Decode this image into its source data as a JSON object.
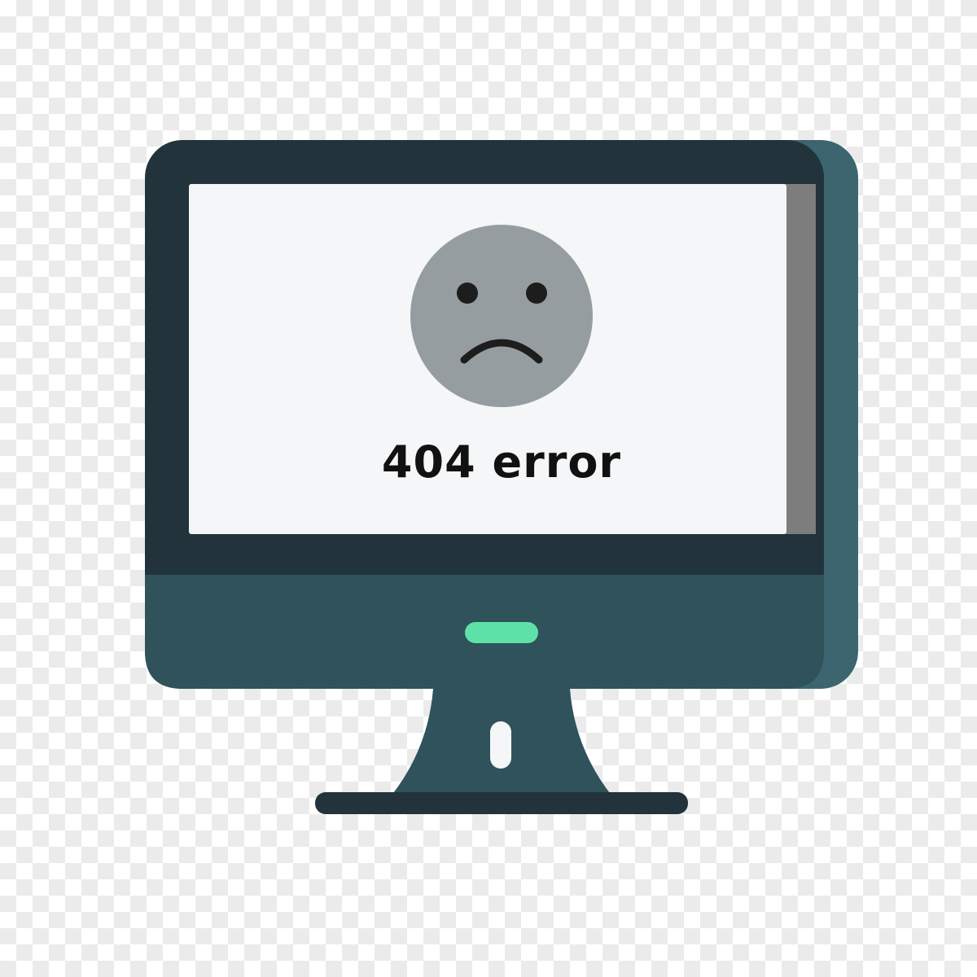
{
  "screen": {
    "message": "404 error"
  },
  "colors": {
    "bezel": "#22333b",
    "bezel_side": "#3c6570",
    "chin": "#2f525b",
    "screen_bg": "#f4f6f8",
    "screen_shadow": "#7d7d7d",
    "face": "#969da1",
    "face_features": "#1d1d1d",
    "power_light": "#5ee1a8",
    "stand": "#2f525b",
    "base": "#22333b"
  },
  "icons": {
    "monitor": "monitor-icon",
    "face": "sad-face-icon"
  }
}
